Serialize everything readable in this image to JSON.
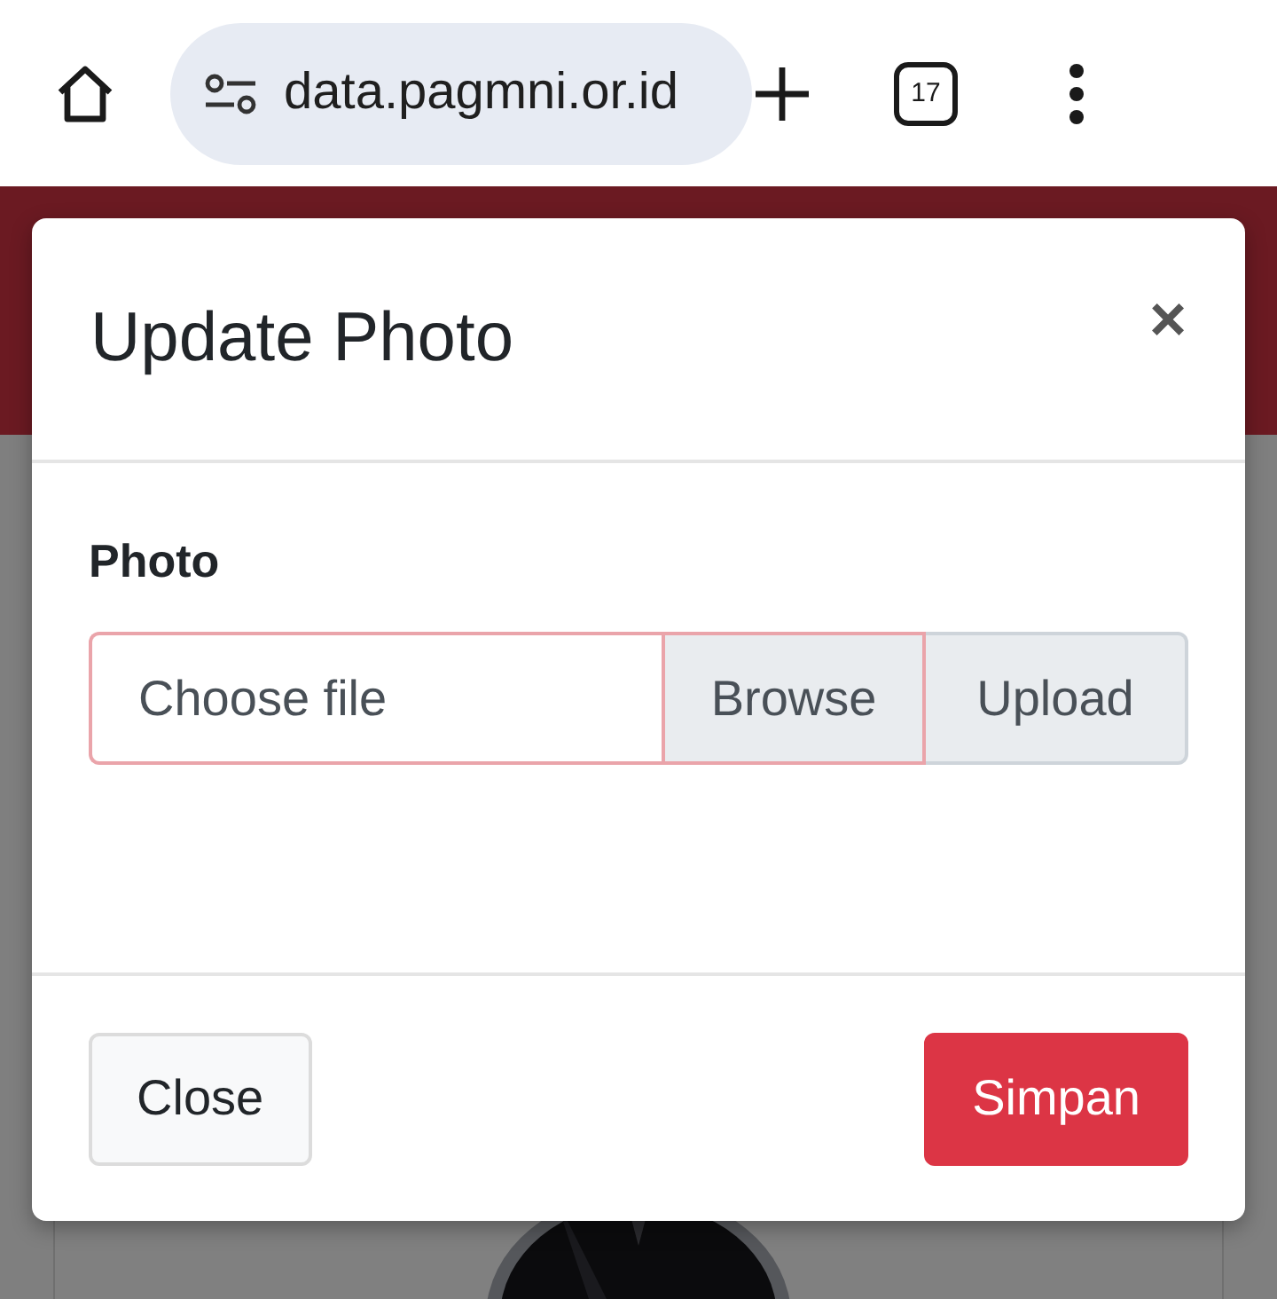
{
  "browser": {
    "url": "data.pagmni.or.id",
    "tab_count": "17"
  },
  "modal": {
    "title": "Update Photo",
    "close_symbol": "×",
    "field_label": "Photo",
    "file_placeholder": "Choose file",
    "browse_label": "Browse",
    "upload_label": "Upload",
    "buttons": [
      {
        "label": "Close",
        "kind": "secondary"
      },
      {
        "label": "Simpan",
        "kind": "primary"
      }
    ]
  }
}
